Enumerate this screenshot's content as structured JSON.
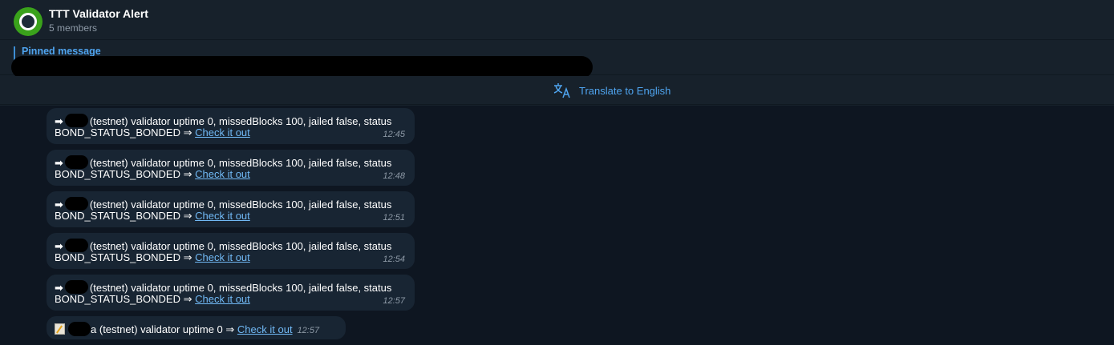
{
  "header": {
    "title": "TTT Validator Alert",
    "members": "5 members"
  },
  "pinned": {
    "title": "Pinned message"
  },
  "translate": {
    "label": "Translate to English",
    "icon": "translate-icon"
  },
  "messages": [
    {
      "arrow": "➡",
      "line1_text": "(testnet) validator uptime 0, missedBlocks 100, jailed false, status",
      "line2_text": "BOND_STATUS_BONDED ⇒",
      "link": "Check it out",
      "time": "12:45"
    },
    {
      "arrow": "➡",
      "line1_text": "(testnet) validator uptime 0, missedBlocks 100, jailed false, status",
      "line2_text": "BOND_STATUS_BONDED ⇒",
      "link": "Check it out",
      "time": "12:48"
    },
    {
      "arrow": "➡",
      "line1_text": "(testnet) validator uptime 0, missedBlocks 100, jailed false, status",
      "line2_text": "BOND_STATUS_BONDED ⇒",
      "link": "Check it out",
      "time": "12:51"
    },
    {
      "arrow": "➡",
      "line1_text": "(testnet) validator uptime 0, missedBlocks 100, jailed false, status",
      "line2_text": "BOND_STATUS_BONDED ⇒",
      "link": "Check it out",
      "time": "12:54"
    },
    {
      "arrow": "➡",
      "line1_text": "(testnet) validator uptime 0, missedBlocks 100, jailed false, status",
      "line2_text": "BOND_STATUS_BONDED ⇒",
      "link": "Check it out",
      "time": "12:57"
    }
  ],
  "last_message": {
    "prefix": "a",
    "text": "(testnet) validator uptime 0 ⇒",
    "link": "Check it out",
    "time": "12:57",
    "icon": "memo-icon"
  },
  "colors": {
    "accent": "#4fa4ef",
    "link": "#71b9f5",
    "avatar": "#3aa21b",
    "bubble": "#182533",
    "chat_background": "#0e1621"
  }
}
